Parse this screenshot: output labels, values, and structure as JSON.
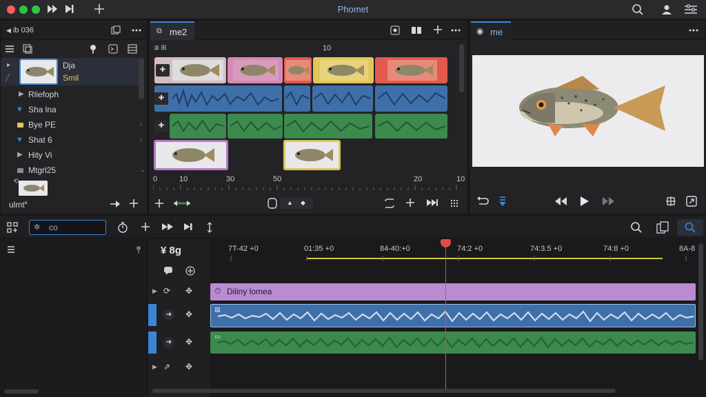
{
  "app": {
    "title": "Phomet"
  },
  "browser": {
    "header": "ib 036",
    "items": [
      {
        "label": "Dja",
        "color": "#e6e6ea"
      },
      {
        "label": "Smil",
        "color": "#e3c55a"
      },
      {
        "label": "Rliefoph",
        "color": "#cfcfd4"
      },
      {
        "label": "Sha lna",
        "color": "#cfcfd4"
      },
      {
        "label": "Bye PE",
        "color": "#cfcfd4"
      },
      {
        "label": "Shat 6",
        "color": "#cfcfd4"
      },
      {
        "label": "Hity Vi",
        "color": "#cfcfd4"
      },
      {
        "label": "Mtgrl25",
        "color": "#cfcfd4"
      }
    ],
    "footer_label": "ulmt"
  },
  "source": {
    "tab_label": "me2",
    "ruler_top": "10",
    "ruler_labels": [
      "0",
      "10",
      "30",
      "50",
      "20",
      "10"
    ]
  },
  "viewer": {
    "tab_label": "me"
  },
  "toolbar": {
    "search_value": "co"
  },
  "timeline": {
    "track_header": "¥ 8g",
    "timecodes": [
      "7T-42 +0",
      "01:35 +0",
      "84-40:+0",
      "74:2 +0",
      "74:3.5 +0",
      "74:8 +0",
      "8A-8"
    ],
    "title_clip": "Diliny lomea"
  },
  "colors": {
    "accent": "#3a86d6",
    "video_clip": "#d987b4",
    "audio_blue": "#3f6fa8",
    "audio_green": "#3c8a4e",
    "title_purple": "#b98bd0",
    "playhead": "#e04a4a",
    "ruler_yellow": "#d6c93a"
  }
}
